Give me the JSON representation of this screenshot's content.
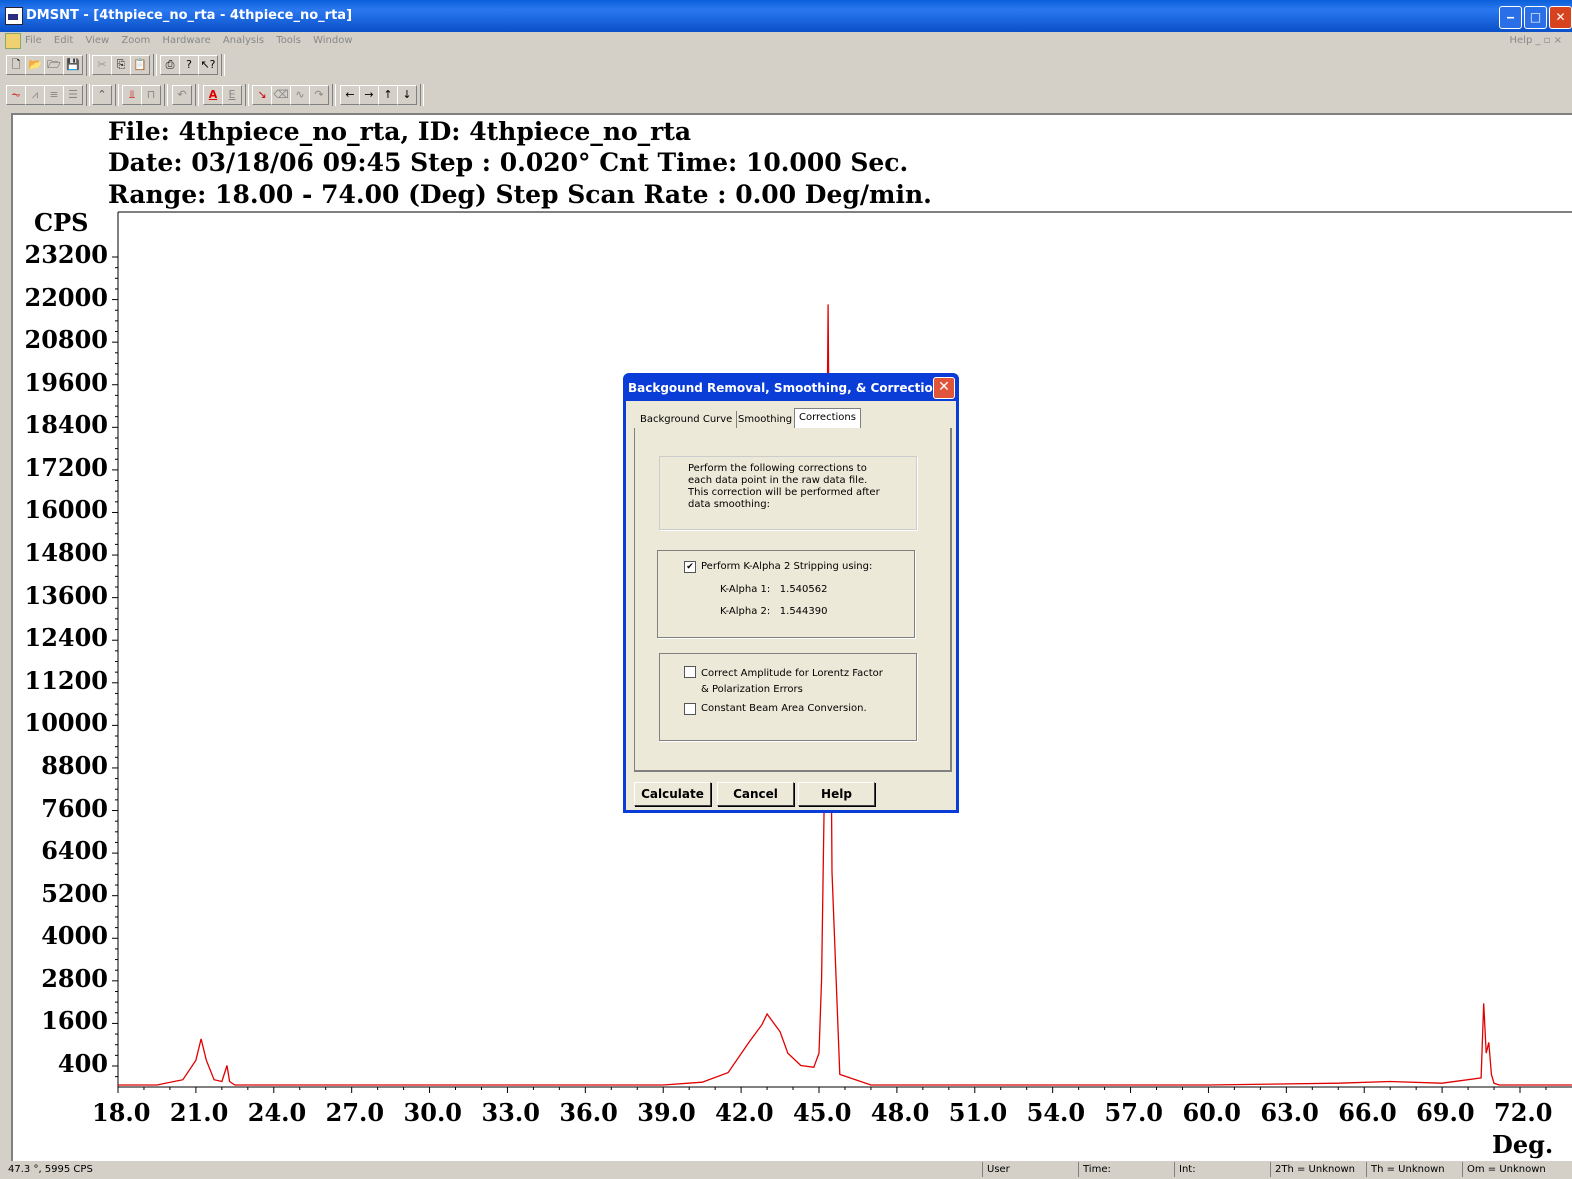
{
  "window": {
    "title": "DMSNT - [4thpiece_no_rta - 4thpiece_no_rta]"
  },
  "menu": {
    "items": [
      "File",
      "Edit",
      "View",
      "Zoom",
      "Hardware",
      "Analysis",
      "Tools",
      "Window"
    ],
    "help": "Help _ ▫ ×"
  },
  "plot": {
    "header_line1": "File: 4thpiece_no_rta, ID: 4thpiece_no_rta",
    "header_line2": "Date: 03/18/06 09:45  Step : 0.020° Cnt Time: 10.000 Sec.",
    "header_line3": "Range: 18.00 - 74.00 (Deg) Step Scan Rate : 0.00 Deg/min.",
    "y_unit": "CPS",
    "x_unit": "Deg.",
    "y_ticks": [
      "23200",
      "22000",
      "20800",
      "19600",
      "18400",
      "17200",
      "16000",
      "14800",
      "13600",
      "12400",
      "11200",
      "10000",
      "8800",
      "7600",
      "6400",
      "5200",
      "4000",
      "2800",
      "1600",
      "400"
    ],
    "x_ticks": [
      "18.0",
      "21.0",
      "24.0",
      "27.0",
      "30.0",
      "33.0",
      "36.0",
      "39.0",
      "42.0",
      "45.0",
      "48.0",
      "51.0",
      "54.0",
      "57.0",
      "60.0",
      "63.0",
      "66.0",
      "69.0",
      "72.0"
    ],
    "trace_color": "#e00000"
  },
  "chart_data": {
    "type": "line",
    "xlabel": "Deg.",
    "ylabel": "CPS",
    "xlim": [
      18.0,
      74.0
    ],
    "ylim": [
      0,
      23500
    ],
    "series": [
      {
        "x": [
          18.0,
          19.5,
          20.5,
          21.0,
          21.2,
          21.4,
          21.7,
          22.0,
          22.2,
          22.3,
          22.5,
          23.0,
          30.0,
          39.0,
          40.5,
          41.5,
          42.3,
          42.8,
          43.0,
          43.2,
          43.5,
          43.8,
          44.3,
          44.8,
          45.0,
          45.1,
          45.2,
          45.35,
          45.5,
          45.8,
          47.0,
          60.0,
          65.0,
          67.0,
          69.0,
          70.5,
          70.6,
          70.7,
          70.8,
          70.9,
          71.0,
          71.2,
          74.0
        ],
        "y": [
          0,
          0,
          150,
          700,
          1300,
          700,
          150,
          100,
          550,
          100,
          0,
          0,
          0,
          0,
          80,
          350,
          1200,
          1700,
          2000,
          1800,
          1500,
          900,
          550,
          500,
          900,
          3000,
          8000,
          22000,
          6000,
          300,
          0,
          0,
          50,
          100,
          50,
          200,
          2300,
          900,
          1200,
          300,
          50,
          0,
          0
        ]
      }
    ]
  },
  "dialog": {
    "title": "Backgound Removal, Smoothing, & Correction",
    "tabs": [
      "Background Curve",
      "Smoothing",
      "Corrections"
    ],
    "description": "Perform the following corrections to each data point in the raw data file.  This correction will be performed after data smoothing:",
    "kalpha_stripping": {
      "label": "Perform K-Alpha 2 Stripping using:",
      "checked": true
    },
    "kalpha1": "K-Alpha 1:   1.540562",
    "kalpha2": "K-Alpha 2:   1.544390",
    "lorentz": {
      "label": "Correct Amplitude for Lorentz Factor & Polarization Errors",
      "checked": false
    },
    "beam_area": {
      "label": "Constant Beam Area Conversion.",
      "checked": false
    },
    "buttons": {
      "calculate": "Calculate",
      "cancel": "Cancel",
      "help": "Help"
    }
  },
  "status": {
    "coord": "47.3 °, 5995 CPS",
    "user": "User",
    "time": "Time:",
    "int": "Int:",
    "twoth": "2Th = Unknown",
    "th": "Th = Unknown",
    "om": "Om = Unknown"
  }
}
